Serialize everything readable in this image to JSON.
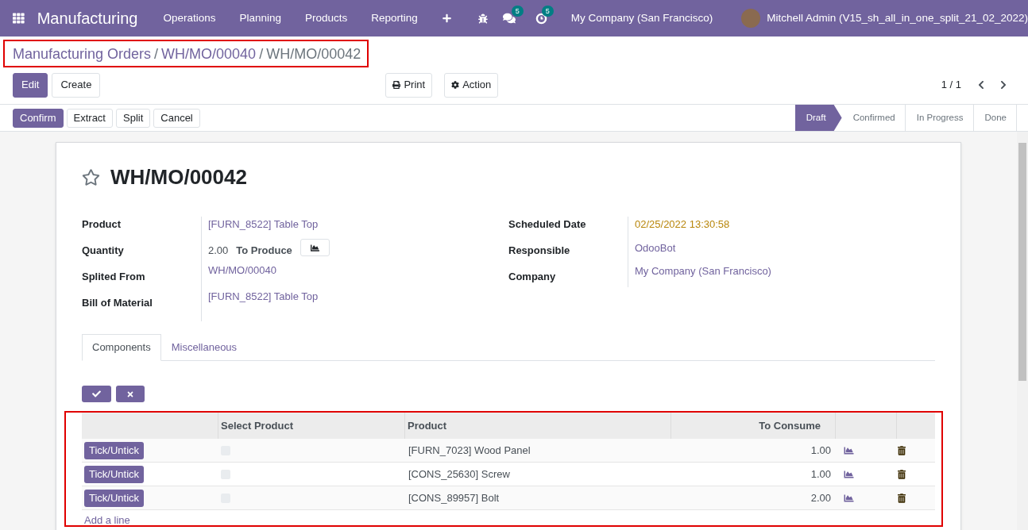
{
  "navbar": {
    "app_name": "Manufacturing",
    "menus": [
      "Operations",
      "Planning",
      "Products",
      "Reporting"
    ],
    "messages_badge": "5",
    "activities_badge": "5",
    "company": "My Company (San Francisco)",
    "user": "Mitchell Admin (V15_sh_all_in_one_split_21_02_2022)"
  },
  "breadcrumb": [
    {
      "label": "Manufacturing Orders",
      "kind": "link"
    },
    {
      "label": "/",
      "kind": "separator"
    },
    {
      "label": "WH/MO/00040",
      "kind": "link"
    },
    {
      "label": "/",
      "kind": "separator"
    },
    {
      "label": "WH/MO/00042",
      "kind": "current"
    }
  ],
  "control_buttons": [
    {
      "label": "Edit",
      "primary": true
    },
    {
      "label": "Create",
      "primary": false
    }
  ],
  "action_buttons": [
    {
      "label": "Print",
      "kind": "print"
    },
    {
      "label": "Action",
      "kind": "gear"
    }
  ],
  "pager": "1 / 1",
  "header_buttons": [
    {
      "label": "Confirm",
      "primary": true
    },
    {
      "label": "Extract",
      "primary": false
    },
    {
      "label": "Split",
      "primary": false
    },
    {
      "label": "Cancel",
      "primary": false
    }
  ],
  "statusbar": [
    {
      "label": "Draft",
      "selected": true
    },
    {
      "label": "Confirmed",
      "selected": false
    },
    {
      "label": "In Progress",
      "selected": false
    },
    {
      "label": "Done",
      "selected": false
    }
  ],
  "record": {
    "title": "WH/MO/00042",
    "starred": false
  },
  "left_fields": [
    {
      "label": "Product",
      "kind": "link",
      "value": "[FURN_8522] Table Top"
    },
    {
      "label": "Quantity",
      "kind": "quantity",
      "value": "2.00",
      "unit": "To Produce"
    },
    {
      "label": "Splited From",
      "kind": "link",
      "value": "WH/MO/00040"
    },
    {
      "label": "Bill of Material",
      "kind": "link",
      "value": "[FURN_8522] Table Top"
    }
  ],
  "right_fields": [
    {
      "label": "Scheduled Date",
      "kind": "date",
      "value": "02/25/2022 13:30:58"
    },
    {
      "label": "Responsible",
      "kind": "link",
      "value": "OdooBot"
    },
    {
      "label": "Company",
      "kind": "link",
      "value": "My Company (San Francisco)"
    }
  ],
  "tabs": [
    {
      "label": "Components",
      "selected": true
    },
    {
      "label": "Miscellaneous",
      "selected": false
    }
  ],
  "table": {
    "columns": [
      "Select Product",
      "Product",
      "To Consume"
    ],
    "rows": [
      {
        "button": "Tick/Untick",
        "checked": false,
        "product": "[FURN_7023] Wood Panel",
        "to_consume": "1.00"
      },
      {
        "button": "Tick/Untick",
        "checked": false,
        "product": "[CONS_25630] Screw",
        "to_consume": "1.00"
      },
      {
        "button": "Tick/Untick",
        "checked": false,
        "product": "[CONS_89957] Bolt",
        "to_consume": "2.00"
      }
    ],
    "add_line": "Add a line"
  }
}
